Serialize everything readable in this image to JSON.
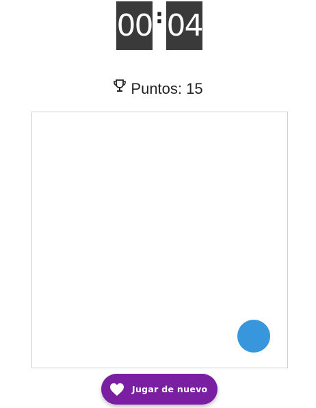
{
  "timer": {
    "minutes": "00",
    "separator": ":",
    "seconds": "04"
  },
  "score": {
    "icon": "trophy-icon",
    "text": "Puntos: 15"
  },
  "game": {
    "target_color": "#3897dc"
  },
  "replay_button": {
    "icon": "heart-icon",
    "label": "Jugar de nuevo",
    "color": "#7b1fa2"
  }
}
